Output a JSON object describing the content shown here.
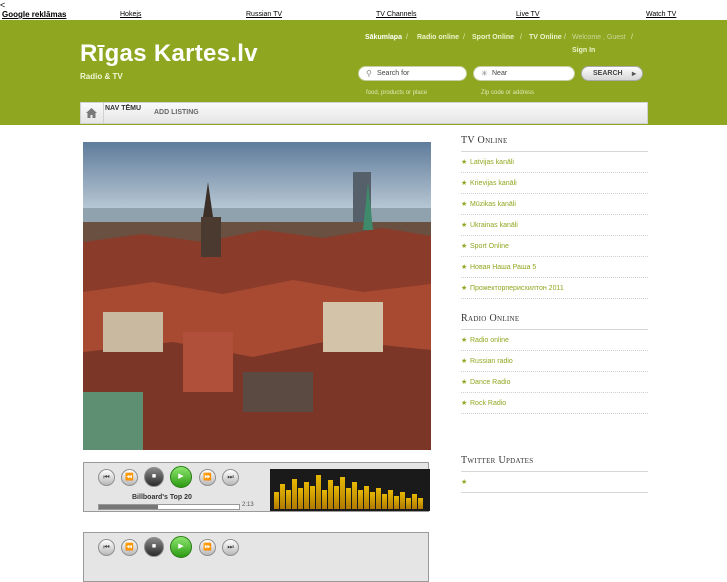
{
  "back_arrow": "<",
  "ad_links": [
    "Google reklāmas",
    "Hokejs",
    "Russian TV",
    "TV Channels",
    "Live TV",
    "Watch TV"
  ],
  "site": {
    "title": "Rīgas Kartes.lv",
    "subtitle": "Radio & TV",
    "accent": "#8fa720"
  },
  "top_nav": {
    "items": [
      "Sākumlapa",
      "Radio online",
      "Sport Online",
      "TV Online"
    ],
    "welcome": "Welcome , Guest",
    "separator": "/",
    "sign_in": "Sign In"
  },
  "search": {
    "what_placeholder": "Search for",
    "what_hint": "food, products or place",
    "where_placeholder": "Near",
    "where_hint": "Zip code or address",
    "button": "SEARCH"
  },
  "menu": {
    "tabs": [
      "NAV TĒMU",
      "ADD LISTING"
    ]
  },
  "player": {
    "title": "Billboard's Top 20",
    "time": "2:13",
    "progress": 0.42,
    "eq_levels": [
      0.45,
      0.65,
      0.5,
      0.8,
      0.55,
      0.7,
      0.6,
      0.9,
      0.5,
      0.75,
      0.6,
      0.85,
      0.55,
      0.7,
      0.5,
      0.6,
      0.45,
      0.55,
      0.4,
      0.5,
      0.35,
      0.45,
      0.3,
      0.4,
      0.3
    ]
  },
  "sidebar": {
    "tv": {
      "heading": "TV Online",
      "items": [
        "Latvijas kanāli",
        "Krievijas kanāli",
        "Mūzikas kanāli",
        "Ukrainas kanāli",
        "Sport Online",
        "Новая Наша Раша 5",
        "Прожекторперисхилтон 2011"
      ]
    },
    "radio": {
      "heading": "Radio Online",
      "items": [
        "Radio online",
        "Russian radio",
        "Dance Radio",
        "Rock Radio"
      ]
    },
    "twitter": {
      "heading": "Twitter Updates"
    }
  }
}
